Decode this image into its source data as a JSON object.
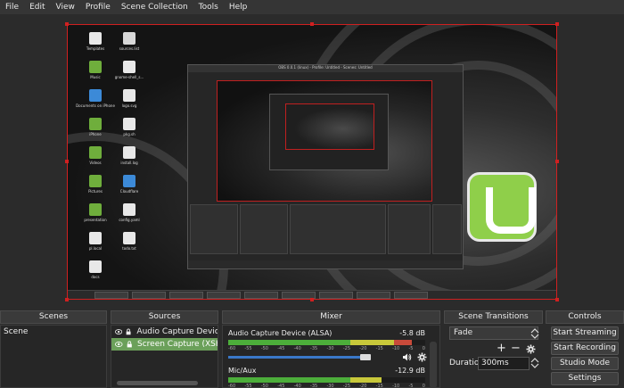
{
  "menu": [
    "File",
    "Edit",
    "View",
    "Profile",
    "Scene Collection",
    "Tools",
    "Help"
  ],
  "nested_window_title": "OBS 0.0.1 (linux) - Profile: Untitled - Scenes: Untitled",
  "scenes": {
    "title": "Scenes",
    "items": [
      "Scene"
    ]
  },
  "sources": {
    "title": "Sources",
    "items": [
      {
        "label": "Audio Capture Device (A",
        "selected": false
      },
      {
        "label": "Screen Capture (XSHM)",
        "selected": true
      }
    ]
  },
  "mixer": {
    "title": "Mixer",
    "ticks": [
      "-60",
      "-55",
      "-50",
      "-45",
      "-40",
      "-35",
      "-30",
      "-25",
      "-20",
      "-15",
      "-10",
      "-5",
      "0"
    ],
    "channels": [
      {
        "name": "Audio Capture Device (ALSA)",
        "db": "-5.8 dB",
        "level": 0.93
      },
      {
        "name": "Mic/Aux",
        "db": "-12.9 dB",
        "level": 0.78
      }
    ]
  },
  "transitions": {
    "title": "Scene Transitions",
    "selected": "Fade",
    "duration_label": "Duration",
    "duration_value": "300ms"
  },
  "controls": {
    "title": "Controls",
    "buttons": [
      "Start Streaming",
      "Start Recording",
      "Studio Mode",
      "Settings"
    ]
  },
  "colors": {
    "accent_selected": "#6ba05a",
    "preview_border": "#d02020",
    "fader": "#3a78c8"
  },
  "desktop_icons": [
    "Templates",
    "sources.list",
    "Music",
    "gnome-shell_s...",
    "Documents on iPhone",
    "logo.svg",
    "iPhone",
    "pkg.sh",
    "Videos",
    "install.log",
    "Pictures",
    "Cloudflare",
    "presentation",
    "config.yaml",
    "pl.local",
    "todo.txt",
    "docs"
  ]
}
